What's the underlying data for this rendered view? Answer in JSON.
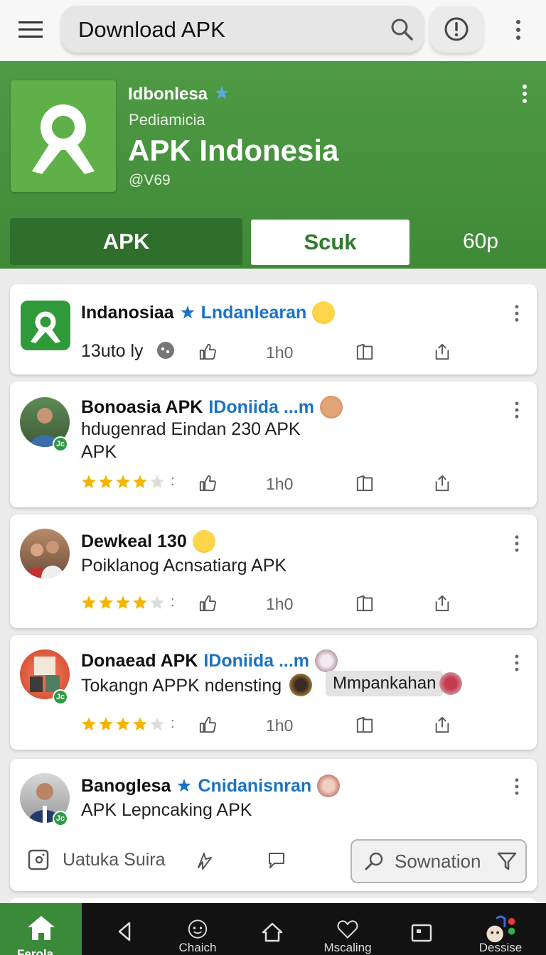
{
  "topbar": {
    "search_value": "Download APK",
    "icons": [
      "menu-icon",
      "search-icon",
      "alert-icon",
      "more-vert-icon"
    ]
  },
  "profile": {
    "name": "Idbonlesa",
    "subtitle": "Pediamicia",
    "title": "APK Indonesia",
    "handle": "@V69",
    "tabs": [
      "APK",
      "Scuk",
      "60p"
    ],
    "colors": {
      "header_green": "#4f9a44",
      "tab_active": "#2f6e2b",
      "verified_blue": "#1a73c4",
      "star_gold": "#f4b400"
    }
  },
  "posts": [
    {
      "name": "Indanosiaa",
      "tag": "Lndanlearan",
      "body": "13uto ly",
      "count": "1h0",
      "verified": true
    },
    {
      "name": "Bonoasia APK",
      "tag": "IDoniida ...m",
      "body_lines": [
        "hdugenrad Eindan 230 APK",
        "APK"
      ],
      "count": "1h0",
      "rating": 4
    },
    {
      "name": "Dewkeal 130",
      "body": "Poiklanog Acnsatiarg APK",
      "count": "1h0",
      "rating": 4
    },
    {
      "name": "Donaead APK",
      "tag": "IDoniida ...m",
      "body": "Tokangn APPK ndensting",
      "chip": "Mmpankahan",
      "count": "1h0",
      "rating": 4
    },
    {
      "name": "Banoglesa",
      "tag": "Cnidanisnran",
      "body": "APK Lepncaking APK",
      "compose_label": "Uatuka Suira",
      "button_label": "Sownation",
      "verified": true
    }
  ],
  "bottom_nav": {
    "items": [
      {
        "label": "Ferola",
        "icon": "home-icon"
      },
      {
        "label": "",
        "icon": "back-icon"
      },
      {
        "label": "Chaich",
        "icon": "chat-icon"
      },
      {
        "label": "",
        "icon": "home-outline-icon"
      },
      {
        "label": "Mscaling",
        "icon": "heart-icon"
      },
      {
        "label": "",
        "icon": "square-icon"
      },
      {
        "label": "Dessise",
        "icon": "profile-icon"
      }
    ]
  }
}
